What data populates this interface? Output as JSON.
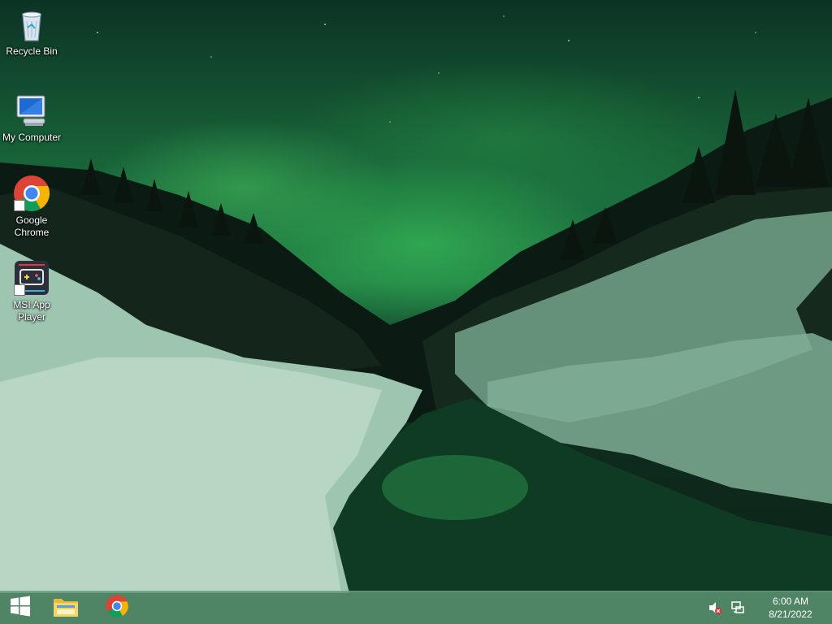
{
  "desktop": {
    "icons": [
      {
        "label": "Recycle Bin",
        "icon": "recycle-bin-icon"
      },
      {
        "label": "My Computer",
        "icon": "computer-icon"
      },
      {
        "label": "Google Chrome",
        "icon": "chrome-icon"
      },
      {
        "label": "MSI App Player",
        "icon": "msi-app-player-icon"
      }
    ]
  },
  "taskbar": {
    "start": {
      "icon": "windows-logo-icon"
    },
    "pinned": [
      {
        "icon": "file-explorer-icon"
      },
      {
        "icon": "chrome-icon"
      }
    ],
    "tray": {
      "volume": {
        "icon": "volume-muted-icon"
      },
      "network": {
        "icon": "network-icon"
      },
      "clock": {
        "time": "6:00 AM",
        "date": "8/21/2022"
      }
    }
  },
  "colors": {
    "aurora": "#2fae52",
    "taskbar": "#5c9673",
    "snow": "#b8d6c4"
  }
}
